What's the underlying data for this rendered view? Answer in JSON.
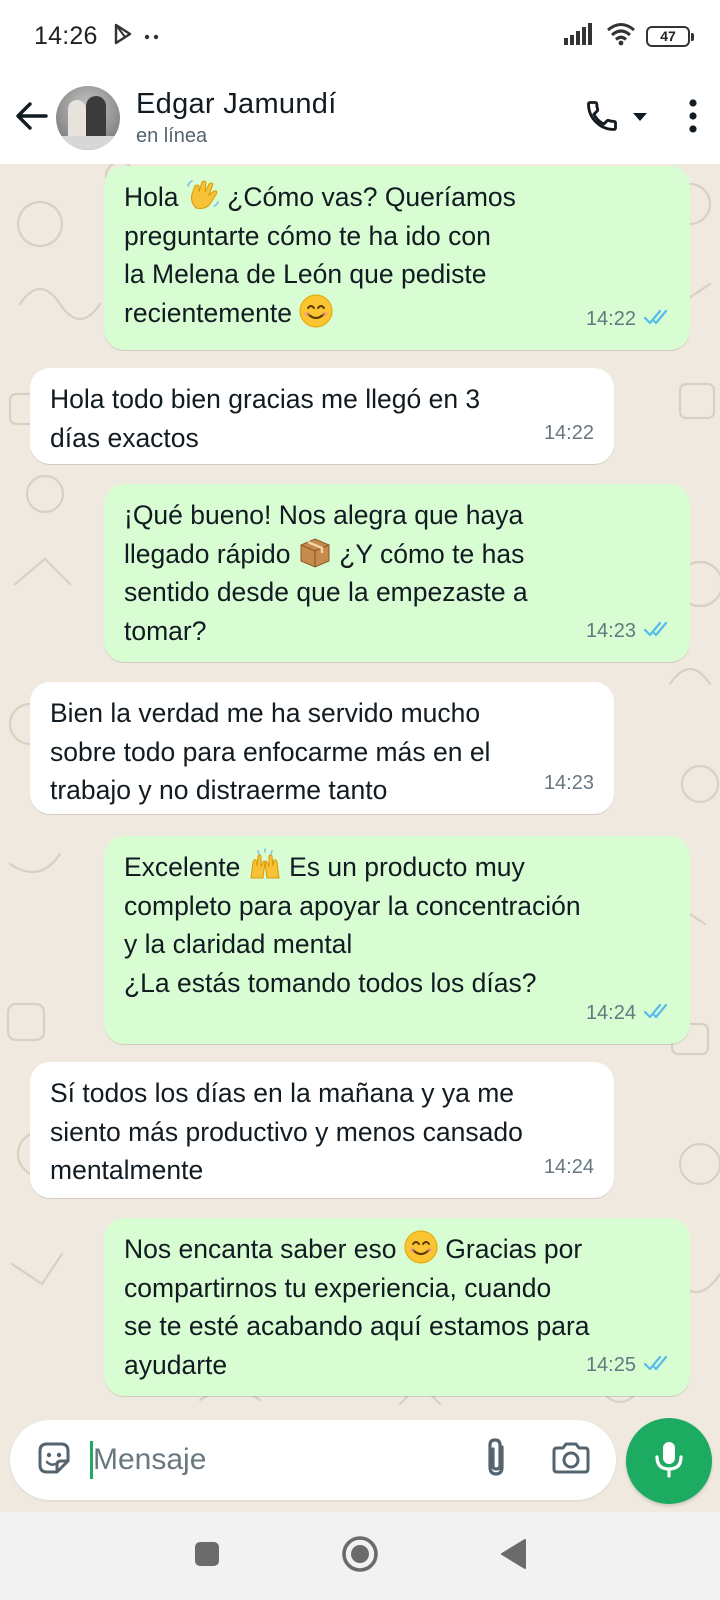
{
  "status_bar": {
    "time": "14:26",
    "battery": "47",
    "icons": [
      "play-store-icon",
      "more-dots-icon",
      "signal-icon",
      "wifi-icon",
      "battery-icon"
    ]
  },
  "header": {
    "contact_name": "Edgar Jamundí",
    "contact_status": "en línea",
    "icons": [
      "back-arrow-icon",
      "phone-icon",
      "dropdown-caret-icon",
      "more-vertical-icon"
    ]
  },
  "messages": [
    {
      "direction": "out",
      "parts": [
        "Hola ",
        "👋",
        " ¿Cómo vas? Queríamos\npreguntarte cómo te ha ido con\nla Melena de León que pediste\nrecientemente ",
        "😊"
      ],
      "time": "14:22",
      "read": true
    },
    {
      "direction": "in",
      "parts": [
        "Hola todo bien gracias me llegó en 3\ndías exactos"
      ],
      "time": "14:22"
    },
    {
      "direction": "out",
      "parts": [
        "¡Qué bueno! Nos alegra que haya\nllegado rápido ",
        "📦",
        " ¿Y cómo te has\nsentido desde que la empezaste a\ntomar?"
      ],
      "time": "14:23",
      "read": true
    },
    {
      "direction": "in",
      "parts": [
        "Bien la verdad me ha servido mucho\nsobre todo para enfocarme más en el\ntrabajo y no distraerme tanto"
      ],
      "time": "14:23"
    },
    {
      "direction": "out",
      "parts": [
        "Excelente ",
        "🙌",
        " Es un producto muy\ncompleto para apoyar la concentración\ny la claridad mental\n¿La estás tomando todos los días?"
      ],
      "time": "14:24",
      "read": true
    },
    {
      "direction": "in",
      "parts": [
        "Sí todos los días en la mañana y ya me\nsiento más productivo y menos cansado\nmentalmente"
      ],
      "time": "14:24"
    },
    {
      "direction": "out",
      "parts": [
        "Nos encanta saber eso ",
        "😊",
        " Gracias por\ncompartirnos tu experiencia, cuando\nse te esté acabando aquí estamos para\nayudarte"
      ],
      "time": "14:25",
      "read": true
    }
  ],
  "input": {
    "placeholder": "Mensaje",
    "value": ""
  },
  "colors": {
    "accent": "#1daa61",
    "outgoing_bubble": "#d9fdd3",
    "incoming_bubble": "#ffffff",
    "read_ticks": "#53bdeb",
    "chat_background": "#efe9df"
  },
  "nav": {
    "icons": [
      "recents-square-icon",
      "home-circle-icon",
      "back-triangle-icon"
    ]
  }
}
